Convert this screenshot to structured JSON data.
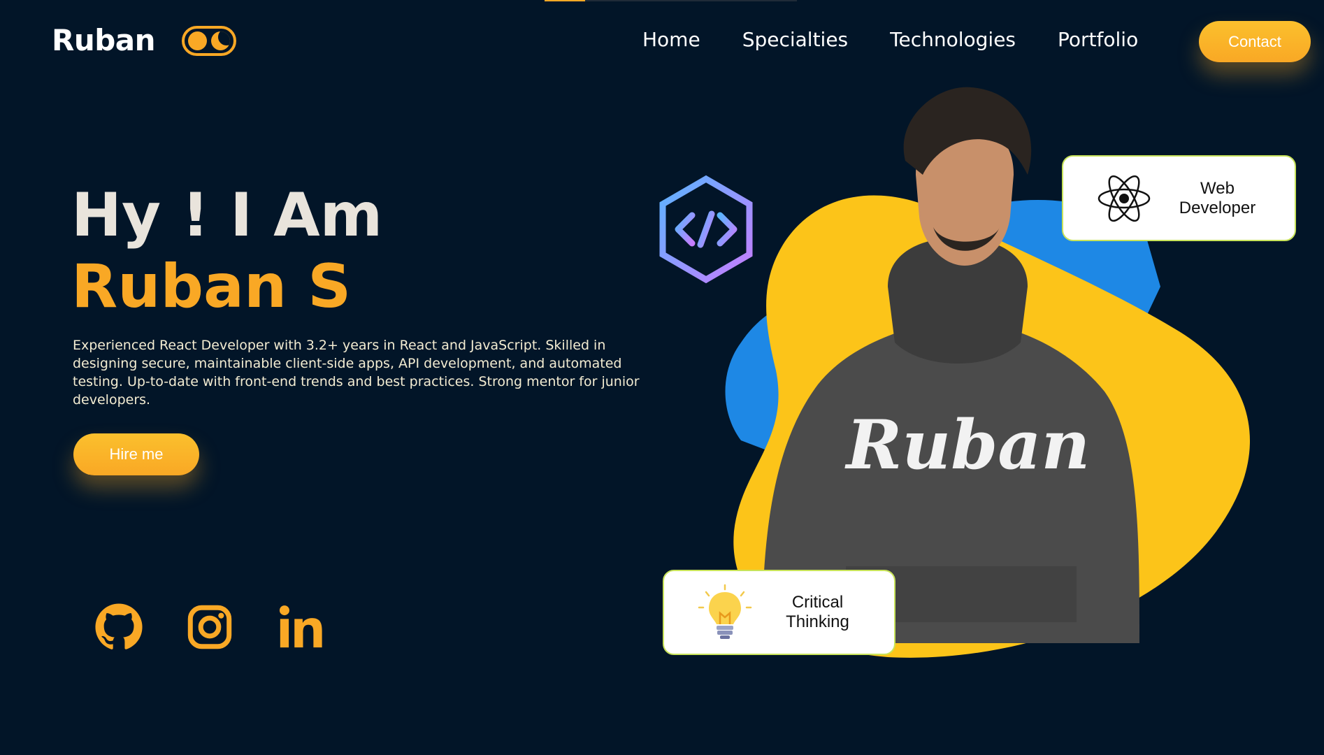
{
  "scroll_progress": 0.16,
  "navbar": {
    "logo": "Ruban",
    "links": [
      "Home",
      "Specialties",
      "Technologies",
      "Portfolio"
    ],
    "contact_label": "Contact"
  },
  "hero": {
    "greeting": "Hy ! I Am",
    "name": "Ruban S",
    "bio": "Experienced React Developer with 3.2+ years in React and JavaScript. Skilled in designing secure, maintainable client-side apps, API development, and automated testing. Up-to-date with front-end trends and best practices. Strong mentor for  junior developers.",
    "hire_label": "Hire me",
    "hoodie_text": "Ruban"
  },
  "socials": [
    {
      "icon": "github-icon"
    },
    {
      "icon": "instagram-icon"
    },
    {
      "icon": "linkedin-icon"
    }
  ],
  "cards": {
    "web": {
      "line1": "Web",
      "line2": "Developer",
      "icon": "react-atom-icon"
    },
    "critical": {
      "line1": "Critical",
      "line2": "Thinking",
      "icon": "lightbulb-icon"
    }
  },
  "colors": {
    "background": "#021528",
    "accent": "#f9a825",
    "blob_yellow": "#fcc419",
    "blob_blue": "#1e88e5",
    "text_light": "#f3ecd2"
  }
}
